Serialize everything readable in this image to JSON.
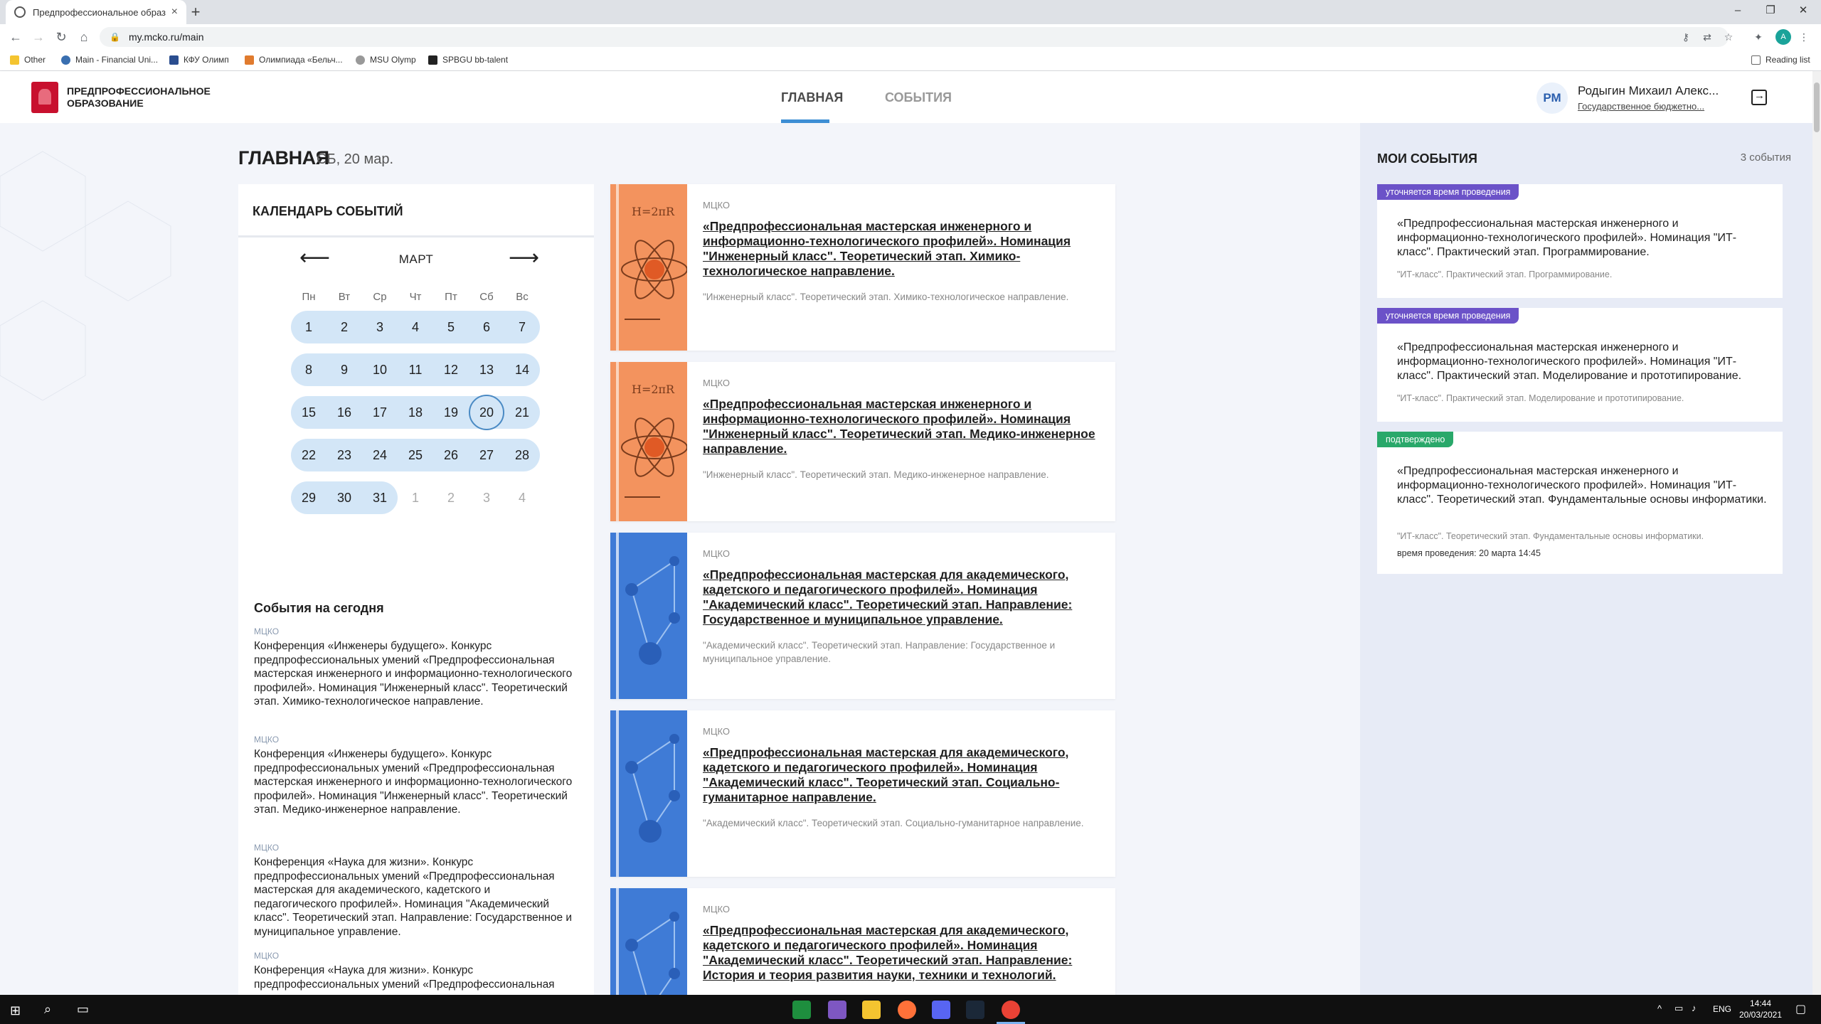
{
  "browser": {
    "tab_title": "Предпрофессиональное образ",
    "tab_close": "×",
    "new_tab": "+",
    "url": "my.mcko.ru/main",
    "bookmarks": [
      "Other",
      "Main - Financial Uni...",
      "КФУ Олимп",
      "Олимпиада «Бельч...",
      "MSU Olymp",
      "SPBGU bb-talent"
    ],
    "reading_list": "Reading list",
    "profile_initial": "A"
  },
  "header": {
    "logo_text": "Предпрофессиональное образование",
    "nav_main": "ГЛАВНАЯ",
    "nav_events": "СОБЫТИЯ",
    "user_initials": "РМ",
    "user_name": "Родыгин Михаил Алекс...",
    "user_org": "Государственное бюджетно..."
  },
  "page": {
    "title": "ГЛАВНАЯ",
    "date": "СБ, 20 мар."
  },
  "calendar": {
    "title": "КАЛЕНДАРЬ СОБЫТИЙ",
    "month": "МАРТ",
    "weekdays": [
      "Пн",
      "Вт",
      "Ср",
      "Чт",
      "Пт",
      "Сб",
      "Вс"
    ],
    "weeks": [
      [
        "1",
        "2",
        "3",
        "4",
        "5",
        "6",
        "7"
      ],
      [
        "8",
        "9",
        "10",
        "11",
        "12",
        "13",
        "14"
      ],
      [
        "15",
        "16",
        "17",
        "18",
        "19",
        "20",
        "21"
      ],
      [
        "22",
        "23",
        "24",
        "25",
        "26",
        "27",
        "28"
      ],
      [
        "29",
        "30",
        "31",
        "1",
        "2",
        "3",
        "4"
      ]
    ],
    "today": "20"
  },
  "today_events": {
    "title": "События на сегодня",
    "items": [
      {
        "org": "МЦКО",
        "text": "Конференция «Инженеры будущего». Конкурс предпрофессиональных умений «Предпрофессиональная мастерская инженерного и информационно-технологического профилей». Номинация \"Инженерный класс\". Теоретический этап. Химико-технологическое направление."
      },
      {
        "org": "МЦКО",
        "text": "Конференция «Инженеры будущего». Конкурс предпрофессиональных умений «Предпрофессиональная мастерская инженерного и информационно-технологического профилей». Номинация \"Инженерный класс\". Теоретический этап. Медико-инженерное направление."
      },
      {
        "org": "МЦКО",
        "text": "Конференция «Наука для жизни». Конкурс предпрофессиональных умений «Предпрофессиональная мастерская для академического, кадетского и педагогического профилей». Номинация \"Академический класс\". Теоретический этап. Направление: Государственное и муниципальное управление."
      },
      {
        "org": "МЦКО",
        "text": "Конференция «Наука для жизни». Конкурс предпрофессиональных умений «Предпрофессиональная"
      }
    ]
  },
  "event_cards": [
    {
      "org": "МЦКО",
      "title": "«Предпрофессиональная мастерская инженерного и информационно-технологического профилей». Номинация \"Инженерный класс\". Теоретический этап. Химико-технологическое направление.",
      "subtitle": "\"Инженерный класс\". Теоретический этап. Химико-технологическое направление.",
      "image": "physics-atom-illustration"
    },
    {
      "org": "МЦКО",
      "title": "«Предпрофессиональная мастерская инженерного и информационно-технологического профилей». Номинация \"Инженерный класс\". Теоретический этап. Медико-инженерное направление.",
      "subtitle": "\"Инженерный класс\". Теоретический этап. Медико-инженерное направление.",
      "image": "physics-atom-illustration"
    },
    {
      "org": "МЦКО",
      "title": "«Предпрофессиональная мастерская для академического, кадетского и педагогического профилей». Номинация \"Академический класс\". Теоретический этап. Направление: Государственное и муниципальное управление.",
      "subtitle": "\"Академический класс\". Теоретический этап. Направление: Государственное и муниципальное управление.",
      "image": "network-illustration"
    },
    {
      "org": "МЦКО",
      "title": "«Предпрофессиональная мастерская для академического, кадетского и педагогического профилей». Номинация \"Академический класс\". Теоретический этап. Социально-гуманитарное направление.",
      "subtitle": "\"Академический класс\". Теоретический этап. Социально-гуманитарное направление.",
      "image": "network-illustration"
    },
    {
      "org": "МЦКО",
      "title": "«Предпрофессиональная мастерская для академического, кадетского и педагогического профилей». Номинация \"Академический класс\". Теоретический этап. Направление: История и теория развития науки, техники и технологий.",
      "subtitle": "",
      "image": "network-illustration"
    }
  ],
  "my_events": {
    "title": "МОИ СОБЫТИЯ",
    "count": "3 события",
    "items": [
      {
        "badge": "уточняется время проведения",
        "badge_color": "#6b52c8",
        "title": "«Предпрофессиональная мастерская инженерного и информационно-технологического профилей». Номинация \"ИТ-класс\". Практический этап. Программирование.",
        "subtitle": "\"ИТ-класс\". Практический этап. Программирование.",
        "time": ""
      },
      {
        "badge": "уточняется время проведения",
        "badge_color": "#6b52c8",
        "title": "«Предпрофессиональная мастерская инженерного и информационно-технологического профилей». Номинация \"ИТ-класс\". Практический этап. Моделирование и прототипирование.",
        "subtitle": "\"ИТ-класс\". Практический этап. Моделирование и прототипирование.",
        "time": ""
      },
      {
        "badge": "подтверждено",
        "badge_color": "#29a86a",
        "title": "«Предпрофессиональная мастерская инженерного и информационно-технологического профилей». Номинация \"ИТ-класс\". Теоретический этап. Фундаментальные основы информатики.",
        "subtitle": "\"ИТ-класс\". Теоретический этап. Фундаментальные основы информатики.",
        "time": "время проведения: 20 марта 14:45"
      }
    ]
  },
  "taskbar": {
    "lang": "ENG",
    "time": "14:44",
    "date": "20/03/2021"
  }
}
